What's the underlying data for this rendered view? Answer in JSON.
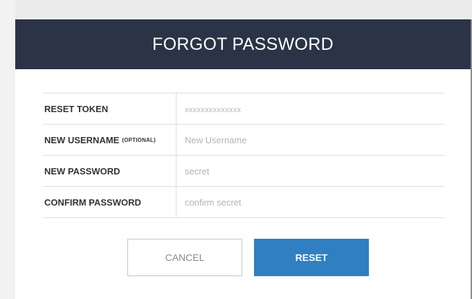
{
  "modal": {
    "title": "FORGOT PASSWORD"
  },
  "form": {
    "fields": [
      {
        "label": "RESET TOKEN",
        "label_suffix": "",
        "placeholder": "xxxxxxxxxxxxxx"
      },
      {
        "label": "NEW USERNAME",
        "label_suffix": "(OPTIONAL)",
        "placeholder": "New Username"
      },
      {
        "label": "NEW PASSWORD",
        "label_suffix": "",
        "placeholder": "secret"
      },
      {
        "label": "CONFIRM PASSWORD",
        "label_suffix": "",
        "placeholder": "confirm secret"
      }
    ]
  },
  "buttons": {
    "cancel_label": "CANCEL",
    "reset_label": "RESET"
  },
  "colors": {
    "header_bg": "#2b3447",
    "primary": "#2f7fc2"
  }
}
